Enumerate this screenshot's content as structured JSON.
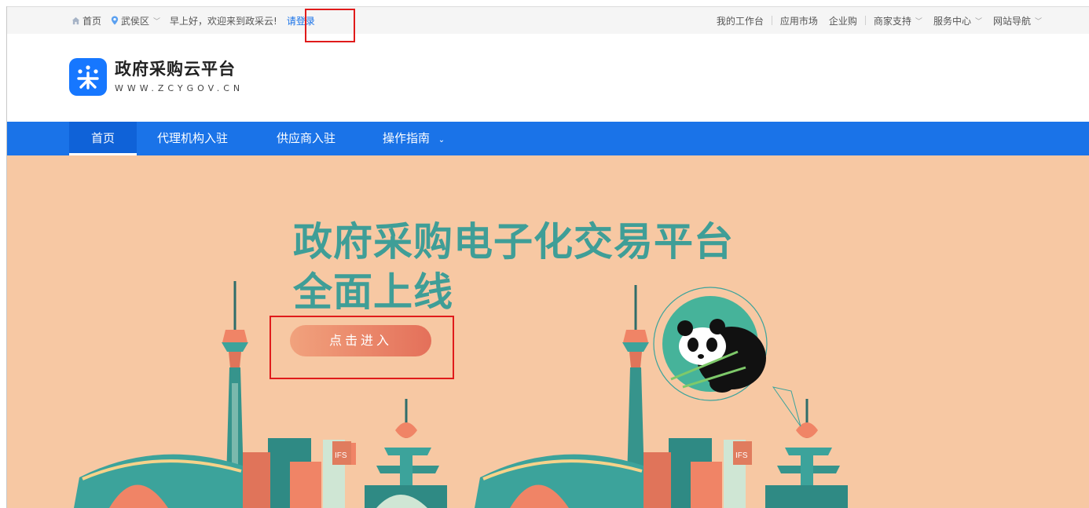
{
  "topbar": {
    "home_label": "首页",
    "location_label": "武侯区",
    "greeting": "早上好，欢迎来到政采云!",
    "login_label": "请登录",
    "workbench_label": "我的工作台",
    "app_market_label": "应用市场",
    "enterprise_buy_label": "企业购",
    "merchant_support_label": "商家支持",
    "service_center_label": "服务中心",
    "site_nav_label": "网站导航"
  },
  "logo": {
    "title": "政府采购云平台",
    "subtitle": "WWW.ZCYGOV.CN"
  },
  "nav": {
    "items": [
      "首页",
      "代理机构入驻",
      "供应商入驻",
      "操作指南"
    ],
    "active": "首页"
  },
  "banner": {
    "headline_line1": "政府采购电子化交易平台",
    "headline_line2": "全面上线",
    "enter_button": "点击进入",
    "sign_text": "IFS"
  },
  "colors": {
    "brand_blue": "#1a73e8",
    "banner_bg": "#f7c8a3",
    "headline_teal": "#3f9e97",
    "highlight_red": "#e01b1b"
  }
}
